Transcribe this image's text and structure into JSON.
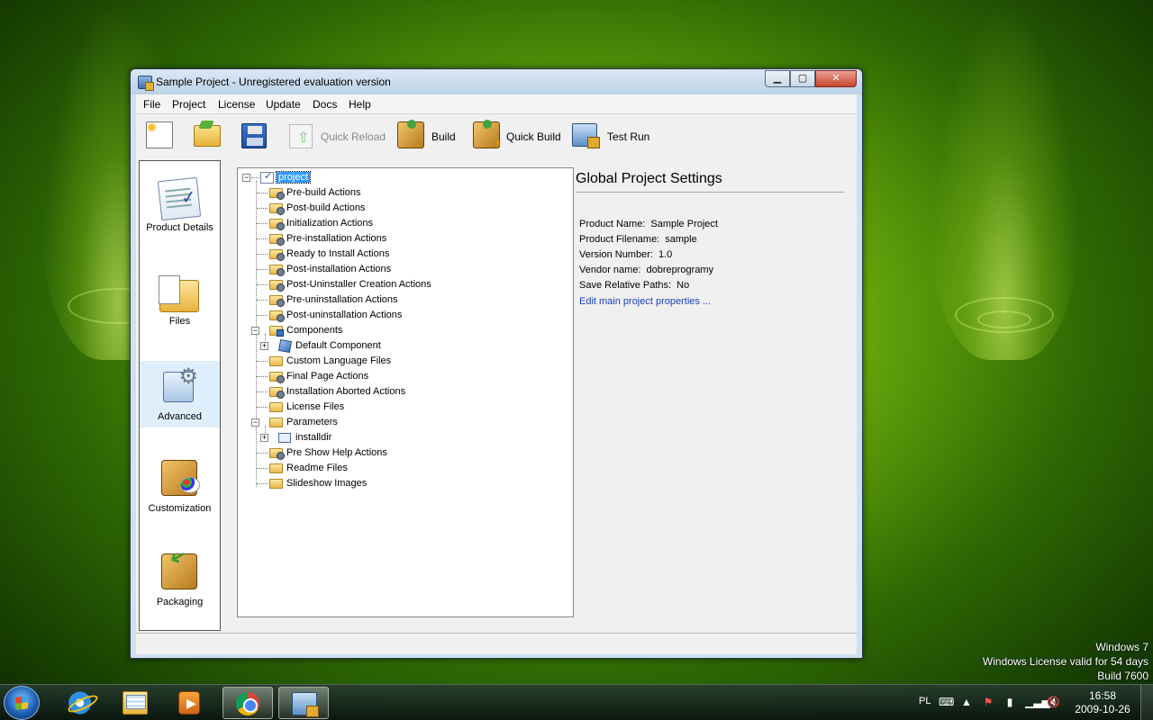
{
  "window": {
    "title": "Sample Project - Unregistered evaluation version",
    "controls": {
      "minimize": "▁",
      "maximize": "▢",
      "close": "✕"
    }
  },
  "menu": [
    "File",
    "Project",
    "License",
    "Update",
    "Docs",
    "Help"
  ],
  "toolbar": {
    "new_icon": "new-document-icon",
    "open_icon": "open-folder-icon",
    "save_icon": "save-disk-icon",
    "quick_reload": "Quick Reload",
    "build": "Build",
    "quick_build": "Quick Build",
    "test_run": "Test Run"
  },
  "nav": {
    "items": [
      {
        "label": "Product Details",
        "icon": "product-details-icon"
      },
      {
        "label": "Files",
        "icon": "files-icon"
      },
      {
        "label": "Advanced",
        "icon": "advanced-icon",
        "selected": true
      },
      {
        "label": "Customization",
        "icon": "customization-icon"
      },
      {
        "label": "Packaging",
        "icon": "packaging-icon"
      }
    ]
  },
  "tree": {
    "root": "project",
    "items": [
      "Pre-build Actions",
      "Post-build Actions",
      "Initialization Actions",
      "Pre-installation Actions",
      "Ready to Install Actions",
      "Post-installation Actions",
      "Post-Uninstaller Creation Actions",
      "Pre-uninstallation Actions",
      "Post-uninstallation Actions",
      "Components",
      "Default Component",
      "Custom Language Files",
      "Final Page Actions",
      "Installation Aborted Actions",
      "License Files",
      "Parameters",
      "installdir",
      "Pre Show Help Actions",
      "Readme Files",
      "Slideshow Images"
    ]
  },
  "settings": {
    "title": "Global Project Settings",
    "props": [
      {
        "label": "Product Name:",
        "value": "Sample Project"
      },
      {
        "label": "Product Filename:",
        "value": "sample"
      },
      {
        "label": "Version Number:",
        "value": "1.0"
      },
      {
        "label": "Vendor name:",
        "value": "dobreprogramy"
      },
      {
        "label": "Save Relative Paths:",
        "value": "No"
      }
    ],
    "edit_link": "Edit main project properties ..."
  },
  "watermark": {
    "line1": "Windows 7",
    "line2": "Windows License valid for 54 days",
    "line3": "Build 7600"
  },
  "taskbar": {
    "lang": "PL",
    "time": "16:58",
    "date": "2009-10-26",
    "apps": [
      "internet-explorer-icon",
      "windows-explorer-icon",
      "media-player-icon",
      "chrome-icon",
      "installbuilder-icon"
    ]
  }
}
